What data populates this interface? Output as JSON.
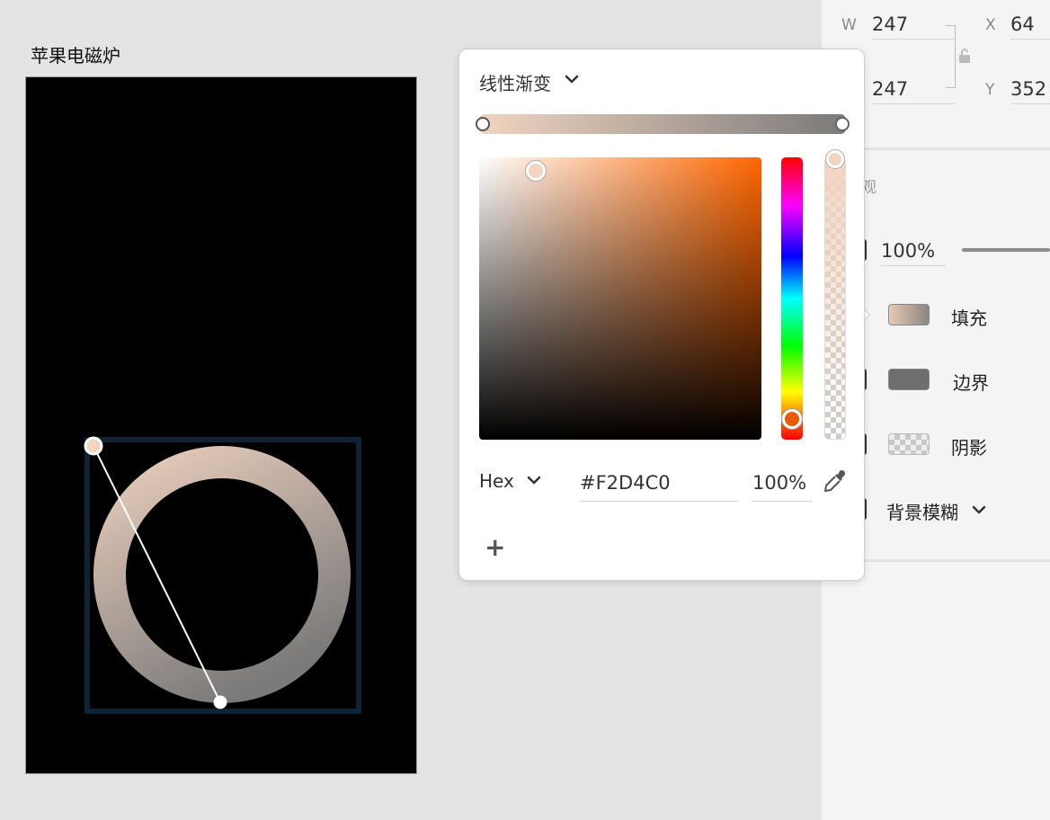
{
  "canvas": {
    "artboard_title": "苹果电磁炉",
    "ring_gradient": {
      "start": "#f2d4c0",
      "end": "#7a7a7a"
    }
  },
  "color_picker": {
    "gradient_type": "线性渐变",
    "color_mode": "Hex",
    "hex_value": "#F2D4C0",
    "opacity": "100%",
    "add_label": "+",
    "icons": [
      "chevron-down-icon",
      "eyedropper-icon",
      "plus-icon"
    ]
  },
  "inspector": {
    "w_label": "W",
    "w_value": "247",
    "h_value": "247",
    "x_label": "X",
    "x_value": "64",
    "y_label": "Y",
    "y_value": "352",
    "section_partial_title": "观",
    "opacity_value": "100%",
    "fill_label": "填充",
    "border_label": "边界",
    "shadow_label": "阴影",
    "blur_label": "背景模糊",
    "fill_swatch_colors": {
      "start": "#e8c9b6",
      "end": "#8a8580"
    },
    "border_swatch_color": "#6e6e6e"
  }
}
